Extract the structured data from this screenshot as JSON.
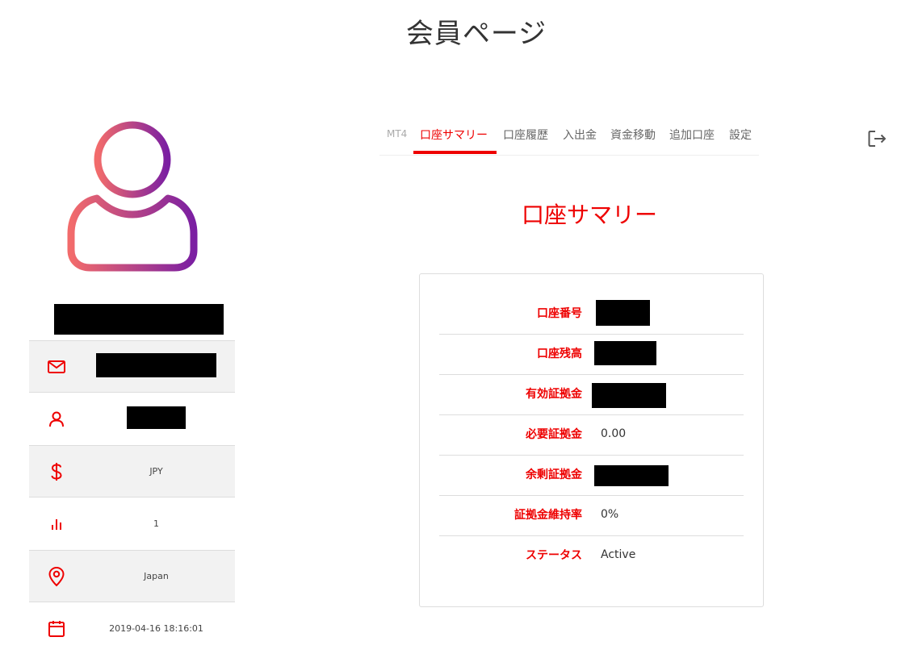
{
  "page": {
    "title": "会員ページ"
  },
  "profile": {
    "info": [
      {
        "icon": "mail-icon",
        "value": ""
      },
      {
        "icon": "user-icon",
        "value": ""
      },
      {
        "icon": "dollar-icon",
        "value": "JPY"
      },
      {
        "icon": "bar-chart-icon",
        "value": "1"
      },
      {
        "icon": "location-pin-icon",
        "value": "Japan"
      },
      {
        "icon": "calendar-icon",
        "value": "2019-04-16 18:16:01"
      }
    ]
  },
  "tabs": [
    {
      "label": "MT4"
    },
    {
      "label": "口座サマリー",
      "active": true
    },
    {
      "label": "口座履歴"
    },
    {
      "label": "入出金"
    },
    {
      "label": "資金移動"
    },
    {
      "label": "追加口座"
    },
    {
      "label": "設定"
    }
  ],
  "summary": {
    "title": "口座サマリー",
    "rows": [
      {
        "label": "口座番号",
        "value": ""
      },
      {
        "label": "口座残高",
        "value": ""
      },
      {
        "label": "有効証拠金",
        "value": ""
      },
      {
        "label": "必要証拠金",
        "value": "0.00"
      },
      {
        "label": "余剰証拠金",
        "value": ""
      },
      {
        "label": "証拠金維持率",
        "value": "0%"
      },
      {
        "label": "ステータス",
        "value": "Active"
      }
    ]
  },
  "colors": {
    "accent": "#ee0000",
    "gradient_start": "#f26b6b",
    "gradient_end": "#7b1fa2"
  }
}
